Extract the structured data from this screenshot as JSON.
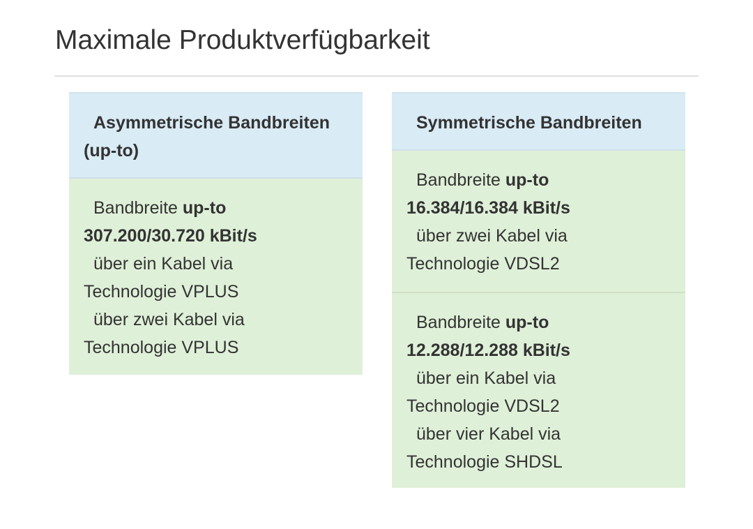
{
  "page": {
    "title": "Maximale Produktverfügbarkeit"
  },
  "columns": [
    {
      "header": [
        "Asymmetrische Bandbreiten",
        "(up-to)"
      ],
      "cells": [
        {
          "prefix": "Bandbreite ",
          "upto": "up-to",
          "rate": "307.200/30.720 kBit/s",
          "options": [
            {
              "via": "über ein Kabel via",
              "technology": "Technologie VPLUS"
            },
            {
              "via": "über zwei Kabel via",
              "technology": "Technologie VPLUS"
            }
          ]
        }
      ]
    },
    {
      "header": [
        "Symmetrische Bandbreiten"
      ],
      "cells": [
        {
          "prefix": "Bandbreite ",
          "upto": "up-to",
          "rate": "16.384/16.384 kBit/s",
          "options": [
            {
              "via": "über zwei Kabel via",
              "technology": "Technologie VDSL2"
            }
          ]
        },
        {
          "prefix": "Bandbreite ",
          "upto": "up-to",
          "rate": "12.288/12.288 kBit/s",
          "options": [
            {
              "via": "über ein Kabel via",
              "technology": "Technologie VDSL2"
            },
            {
              "via": "über vier Kabel via",
              "technology": "Technologie SHDSL"
            }
          ]
        }
      ]
    }
  ],
  "colors": {
    "header_bg": "#d9ebf5",
    "cell_bg": "#dff0d8",
    "text": "#333333",
    "rule": "#e0e0e0"
  }
}
